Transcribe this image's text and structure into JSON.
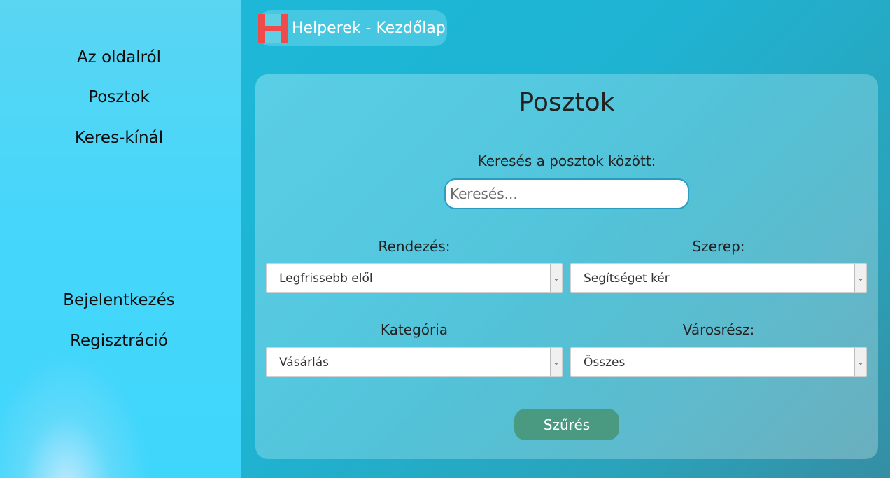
{
  "sidebar": {
    "items": [
      {
        "label": "Az oldalról"
      },
      {
        "label": "Posztok"
      },
      {
        "label": "Keres-kínál"
      },
      {
        "label": "Bejelentkezés"
      },
      {
        "label": "Regisztráció"
      }
    ]
  },
  "header": {
    "brand_label": "Helperek - Kezdőlap"
  },
  "card": {
    "title": "Posztok",
    "search_label": "Keresés a posztok között:",
    "search_placeholder": "Keresés...",
    "sort_label": "Rendezés:",
    "sort_value": "Legfrissebb elől",
    "role_label": "Szerep:",
    "role_value": "Segítséget kér",
    "category_label": "Kategória",
    "category_value": "Vásárlás",
    "district_label": "Városrész:",
    "district_value": "Összes",
    "filter_button": "Szűrés"
  },
  "colors": {
    "accent_button": "#4a9a82",
    "logo_red": "#ef4b4b",
    "sidebar_bg": "#46d6fb"
  }
}
